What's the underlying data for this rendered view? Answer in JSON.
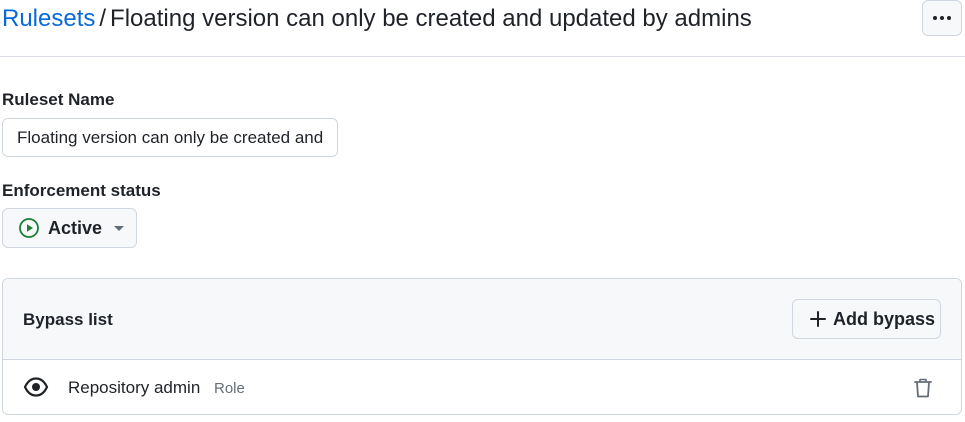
{
  "header": {
    "breadcrumb_link": "Rulesets",
    "breadcrumb_separator": "/",
    "breadcrumb_current": "Floating version can only be created and updated by admins",
    "more_icon": "kebab-horizontal-icon"
  },
  "ruleset_name": {
    "label": "Ruleset Name",
    "value": "Floating version can only be created and updated by admins"
  },
  "enforcement": {
    "label": "Enforcement status",
    "status": "Active",
    "status_icon": "play-circle-icon",
    "status_color": "#1a7f37"
  },
  "bypass_list": {
    "title": "Bypass list",
    "add_button_label": "Add bypass",
    "items": [
      {
        "name": "Repository admin",
        "type": "Role",
        "icon": "eye-icon",
        "remove_icon": "trash-icon"
      }
    ]
  },
  "colors": {
    "link": "#0969da",
    "border": "#d0d7de",
    "muted_text": "#656d76",
    "button_bg": "#f6f8fa"
  }
}
